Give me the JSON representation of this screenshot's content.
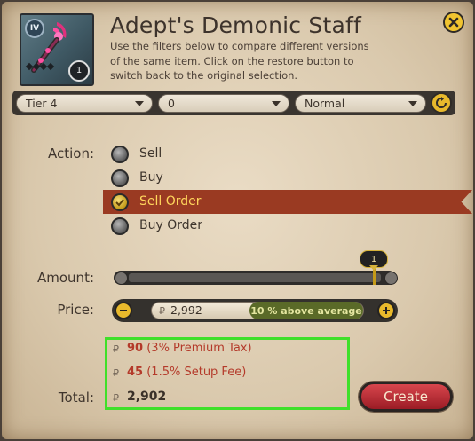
{
  "item": {
    "title": "Adept's Demonic Staff",
    "description": "Use the filters below to compare different versions of the same item. Click on the restore button to switch back to the original selection.",
    "tier_badge": "IV",
    "quantity_badge": "1",
    "icon": "demonic-staff-icon"
  },
  "filters": {
    "tier": "Tier 4",
    "enchantment": "0",
    "quality": "Normal"
  },
  "action": {
    "label": "Action:",
    "options": [
      {
        "label": "Sell",
        "checked": false
      },
      {
        "label": "Buy",
        "checked": false
      },
      {
        "label": "Sell Order",
        "checked": true
      },
      {
        "label": "Buy Order",
        "checked": false
      }
    ]
  },
  "amount": {
    "label": "Amount:",
    "value": "1"
  },
  "price": {
    "label": "Price:",
    "value": "2,992",
    "comparison": "10 % above average"
  },
  "fees": {
    "premium_tax_amount": "90",
    "premium_tax_label": "(3% Premium Tax)",
    "setup_fee_amount": "45",
    "setup_fee_label": "(1.5% Setup Fee)"
  },
  "total": {
    "label": "Total:",
    "value": "2,902"
  },
  "buttons": {
    "create": "Create"
  },
  "colors": {
    "selected_band": "#9a3a22",
    "fee_red": "#b43a2a",
    "highlight_green": "#3fe02a",
    "accent_gold": "#e8b92c"
  }
}
